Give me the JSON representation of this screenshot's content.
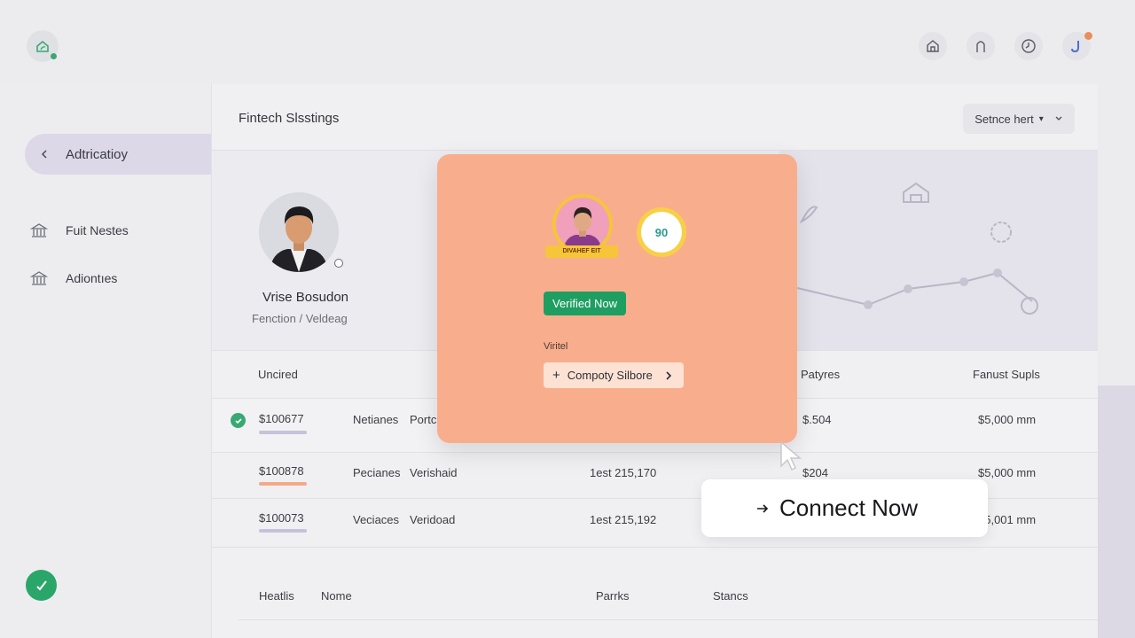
{
  "topbar": {
    "icons": [
      "home-icon",
      "arch-icon",
      "clock-icon",
      "profile-icon"
    ],
    "notification_color": "#e9905a"
  },
  "sidebar": {
    "active_item": {
      "label": "Adtricatioy",
      "icon": "chevron-left-icon"
    },
    "items": [
      {
        "label": "Fuit Nestes",
        "icon": "bank-icon"
      },
      {
        "label": "Adiontıes",
        "icon": "bank-icon"
      }
    ],
    "fab_icon": "check-icon"
  },
  "main": {
    "title": "Fintech Slsstings",
    "select_value": "Setnce hert"
  },
  "profile": {
    "name": "Vrise Bosudon",
    "role": "Fenction / Veldeag"
  },
  "table": {
    "headers": [
      "Uncired",
      "Patyres",
      "Fanust Supls"
    ],
    "rows": [
      {
        "id": "$100677",
        "type": "Netianes",
        "status": "Portc",
        "date": "",
        "amount": "$.504",
        "total": "$5,000 mm",
        "checked": true,
        "bar_color": "#c7c1da"
      },
      {
        "id": "$100878",
        "type": "Pecianes",
        "status": "Verishaid",
        "date": "1est 215,170",
        "amount": "$204",
        "total": "$5,000 mm",
        "checked": false,
        "bar_color": "#f3a98a"
      },
      {
        "id": "$100073",
        "type": "Veciaces",
        "status": "Veridoad",
        "date": "1est 215,192",
        "amount": "",
        "total": "$5,001 mm",
        "checked": false,
        "bar_color": "#c7c1da"
      }
    ]
  },
  "table2": {
    "headers": [
      "Heatlis",
      "Nome",
      "Parrks",
      "Stancs"
    ]
  },
  "modal": {
    "badge1_ribbon": "DIVAHEF EIT",
    "badge2_text": "90",
    "verified_label": "Verified Now",
    "section_label": "Viritel",
    "company_label": "Compoty Silbore",
    "bg_color": "#f8ae8d",
    "accent_color": "#1f9e62"
  },
  "connect_button": {
    "label": "Connect Now"
  },
  "chart_icons": [
    "house-outline-icon",
    "rocket-icon",
    "gear-dollar-icon",
    "robot-icon"
  ]
}
